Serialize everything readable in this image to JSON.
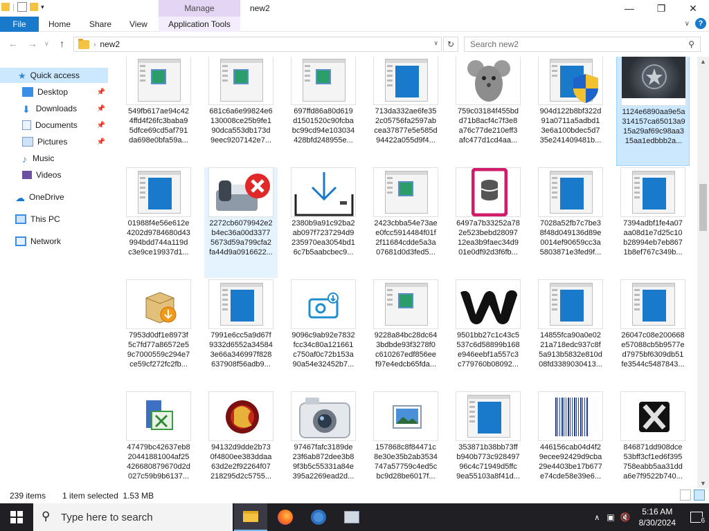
{
  "window": {
    "title": "new2",
    "manage_label": "Manage"
  },
  "ribbon": {
    "tabs": [
      "File",
      "Home",
      "Share",
      "View",
      "Application Tools"
    ]
  },
  "address": {
    "path": "new2",
    "search_placeholder": "Search new2"
  },
  "nav": {
    "items": [
      {
        "label": "Quick access"
      },
      {
        "label": "Desktop"
      },
      {
        "label": "Downloads"
      },
      {
        "label": "Documents"
      },
      {
        "label": "Pictures"
      },
      {
        "label": "Music"
      },
      {
        "label": "Videos"
      },
      {
        "label": "OneDrive"
      },
      {
        "label": "This PC"
      },
      {
        "label": "Network"
      }
    ]
  },
  "files": [
    {
      "l1": "549fb617ae94c42",
      "l2": "4ffd4f26fc3baba9",
      "l3": "5dfce69cd5af791",
      "l4": "da698e0bfa59a...",
      "icon": "window-small-icon"
    },
    {
      "l1": "681c6a6e99824e6",
      "l2": "130008ce25b9fe1",
      "l3": "90dca553db173d",
      "l4": "9eec9207142e7...",
      "icon": "window-small-icon"
    },
    {
      "l1": "697ffd86a80d619",
      "l2": "d1501520c90fcba",
      "l3": "bc99cd94e103034",
      "l4": "428bfd248955e...",
      "icon": "window-small-icon"
    },
    {
      "l1": "713da332ae6fe35",
      "l2": "2c05756fa2597ab",
      "l3": "cea37877e5e585d",
      "l4": "94422a055d9f4...",
      "icon": "window-blue-icon"
    },
    {
      "l1": "759c03184f455bd",
      "l2": "d71b8acf4c7f3e8",
      "l3": "a76c77de210eff3",
      "l4": "afc477d1cd4aa...",
      "icon": "mouse-icon"
    },
    {
      "l1": "904d122b8bf322d",
      "l2": "91a0711a5adbd1",
      "l3": "3e6a100bdec5d7",
      "l4": "35e241409481b...",
      "icon": "shield-icon"
    },
    {
      "l1": "1124e6890aa9e5a",
      "l2": "314157ca65013a9",
      "l3": "15a29af69c98aa3",
      "l4": "15aa1edbbb2a...",
      "icon": "captain-shield-icon"
    },
    {
      "l1": "01988f4e56e612e",
      "l2": "4202d9784680d43",
      "l3": "994bdd744a119d",
      "l4": "c3e9ce19937d1...",
      "icon": "window-blue-icon"
    },
    {
      "l1": "2272cb6079942e2",
      "l2": "b4ec36a00d3377",
      "l3": "5673d59a799cfa2",
      "l4": "fa44d9a0916622...",
      "icon": "fax-error-icon"
    },
    {
      "l1": "2380b9a91c92ba2",
      "l2": "ab097f7237294d9",
      "l3": "235970ea3054bd1",
      "l4": "6c7b5aabcbec9...",
      "icon": "download-tray-icon"
    },
    {
      "l1": "2423cbba54e73ae",
      "l2": "e0fcc5914484f01f",
      "l3": "2f11684cdde5a3a",
      "l4": "07681d0d3fed5...",
      "icon": "window-small-icon"
    },
    {
      "l1": "6497a7b33252a78",
      "l2": "2e523bebd28097",
      "l3": "12ea3b9faec34d9",
      "l4": "01e0df92d3f6fb...",
      "icon": "database-icon"
    },
    {
      "l1": "7028a52fb7c7be3",
      "l2": "8f48d049136d89e",
      "l3": "0014ef90659cc3a",
      "l4": "5803871e3fed9f...",
      "icon": "window-blue-icon"
    },
    {
      "l1": "7394adbf1fe4a07",
      "l2": "aa08d1e7d25c10",
      "l3": "b28994eb7eb867",
      "l4": "1b8ef767c349b...",
      "icon": "window-blue-icon"
    },
    {
      "l1": "7953d0df1e8973f",
      "l2": "5c7fd77a86572e5",
      "l3": "9c7000559c294e7",
      "l4": "ce59cf272fc2fb...",
      "icon": "installer-box-icon"
    },
    {
      "l1": "7991e6cc5a9d67f",
      "l2": "9332d6552a34584",
      "l3": "3e66a346997f828",
      "l4": "637908f56adb9...",
      "icon": "window-blue-icon"
    },
    {
      "l1": "9096c9ab92e7832",
      "l2": "fcc34c80a121661",
      "l3": "c750af0c72b153a",
      "l4": "90a54e32452b7...",
      "icon": "camera-download-icon"
    },
    {
      "l1": "9228a84bc28dc64",
      "l2": "3bdbde93f3278f0",
      "l3": "c610267edf856ee",
      "l4": "f97e4edcb65fda...",
      "icon": "window-small-icon"
    },
    {
      "l1": "9501bb27c1c43c5",
      "l2": "537c6d58899b168",
      "l3": "e946eebf1a557c3",
      "l4": "c779760b08092...",
      "icon": "w-logo-icon"
    },
    {
      "l1": "14855fca90a0e02",
      "l2": "21a718edc937c8f",
      "l3": "5a913b5832e810d",
      "l4": "08fd3389030413...",
      "icon": "window-blue-icon"
    },
    {
      "l1": "26047c08e200668",
      "l2": "e57088cb5b9577e",
      "l3": "d7975bf6309db51",
      "l4": "fe3544c5487843...",
      "icon": "window-blue-icon"
    },
    {
      "l1": "47479bc42637eb8",
      "l2": "20441881004af25",
      "l3": "426680879670d2d",
      "l4": "027c59b9b6137...",
      "icon": "spreadsheet-icon"
    },
    {
      "l1": "94132d9dde2b73",
      "l2": "0f4800ee383ddaa",
      "l3": "63d2e2f92264f07",
      "l4": "218295d2c5755...",
      "icon": "game-logo-icon"
    },
    {
      "l1": "97467fafc3189de",
      "l2": "23f6ab872dee3b8",
      "l3": "9f3b5c55331a84e",
      "l4": "395a2269ead2d...",
      "icon": "camera-icon"
    },
    {
      "l1": "157868c8f84471c",
      "l2": "8e30e35b2ab3534",
      "l3": "747a57759c4ed5c",
      "l4": "bc9d28be6017f...",
      "icon": "picture-icon"
    },
    {
      "l1": "353871b38bb73ff",
      "l2": "b940b773c928497",
      "l3": "96c4c71949d5ffc",
      "l4": "9ea55103a8f41d...",
      "icon": "window-blue-icon"
    },
    {
      "l1": "446156cab04d4f2",
      "l2": "9ecee92429d9cba",
      "l3": "29e4403be17b677",
      "l4": "e74cde58e39e6...",
      "icon": "barcode-icon"
    },
    {
      "l1": "846871dd908dce",
      "l2": "53bff3cf1ed6f395",
      "l3": "758eabb5aa31dd",
      "l4": "a6e7f9522b740...",
      "icon": "x-logo-icon"
    }
  ],
  "status": {
    "count": "239 items",
    "selection": "1 item selected  1.53 MB"
  },
  "taskbar": {
    "search_placeholder": "Type here to search",
    "time": "5:16 AM",
    "date": "8/30/2024",
    "notifications": "6"
  }
}
